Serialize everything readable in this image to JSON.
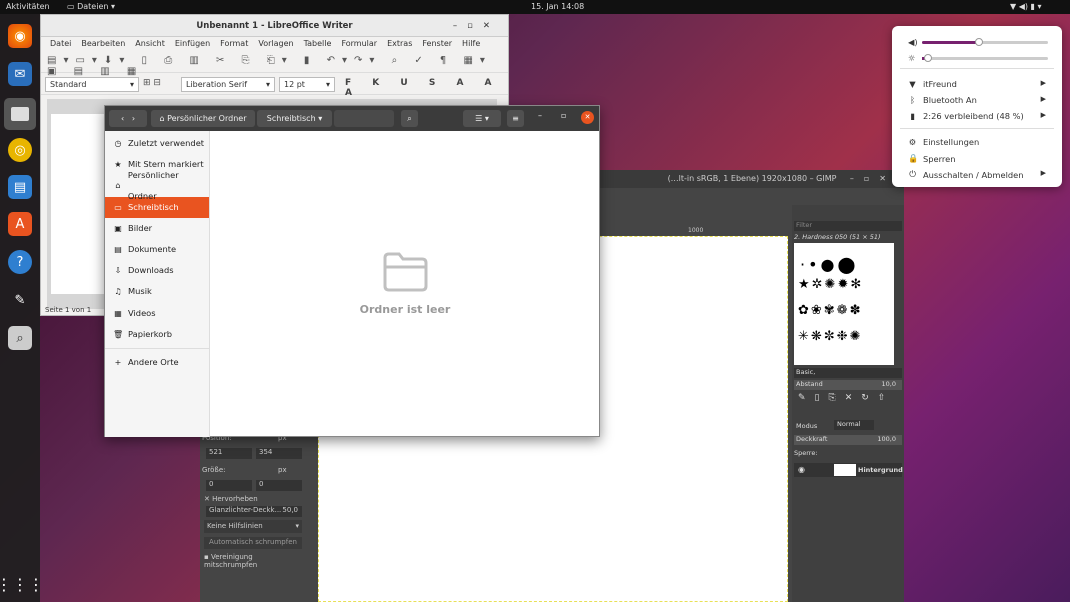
{
  "topbar": {
    "activities": "Aktivitäten",
    "app_menu": "Dateien",
    "clock": "15. Jan 14:08"
  },
  "writer": {
    "title": "Unbenannt 1 - LibreOffice Writer",
    "menu": [
      "Datei",
      "Bearbeiten",
      "Ansicht",
      "Einfügen",
      "Format",
      "Vorlagen",
      "Tabelle",
      "Formular",
      "Extras",
      "Fenster",
      "Hilfe"
    ],
    "style": "Standard",
    "font": "Liberation Serif",
    "size": "12 pt",
    "status": "Seite 1 von 1"
  },
  "gimp": {
    "title": "(…lt-in sRGB, 1 Ebene) 1920x1080 – GIMP",
    "filter": "Filter",
    "brush": "2. Hardness 050 (51 × 51)",
    "preset": "Basic,",
    "spacing_label": "Abstand",
    "spacing_value": "10,0",
    "mode_label": "Modus",
    "mode_value": "Normal",
    "opacity_label": "Deckkraft",
    "opacity_value": "100,0",
    "lock_label": "Sperre:",
    "layer": "Hintergrund",
    "position_label": "Position:",
    "pos_x": "521",
    "pos_y": "354",
    "unit": "px",
    "size_label": "Größe:",
    "size_w": "0",
    "size_h": "0",
    "highlight": "Hervorheben",
    "highlight_opacity": "Glanzlichter-Deckk...",
    "highlight_value": "50,0",
    "guides": "Keine Hilfslinien",
    "auto_shrink": "Automatisch schrumpfen",
    "merge_shrink": "Vereinigung mitschrumpfen",
    "ruler": "1000"
  },
  "files": {
    "path_home": "Persönlicher Ordner",
    "path_current": "Schreibtisch",
    "sidebar": [
      "Zuletzt verwendet",
      "Mit Stern markiert",
      "Persönlicher Ordner",
      "Schreibtisch",
      "Bilder",
      "Dokumente",
      "Downloads",
      "Musik",
      "Videos",
      "Papierkorb",
      "Andere Orte"
    ],
    "sidebar_icons": [
      "◷",
      "★",
      "⌂",
      "▭",
      "▣",
      "▤",
      "⇩",
      "♫",
      "▦",
      "🗑",
      "+"
    ],
    "empty_text": "Ordner ist leer"
  },
  "tray": {
    "network": "itFreund",
    "bluetooth": "Bluetooth An",
    "battery": "2:26 verbleibend (48 %)",
    "settings": "Einstellungen",
    "lock": "Sperren",
    "power": "Ausschalten / Abmelden",
    "volume": 0.45,
    "brightness": 0.05
  },
  "colors": {
    "accent": "#e95420"
  }
}
